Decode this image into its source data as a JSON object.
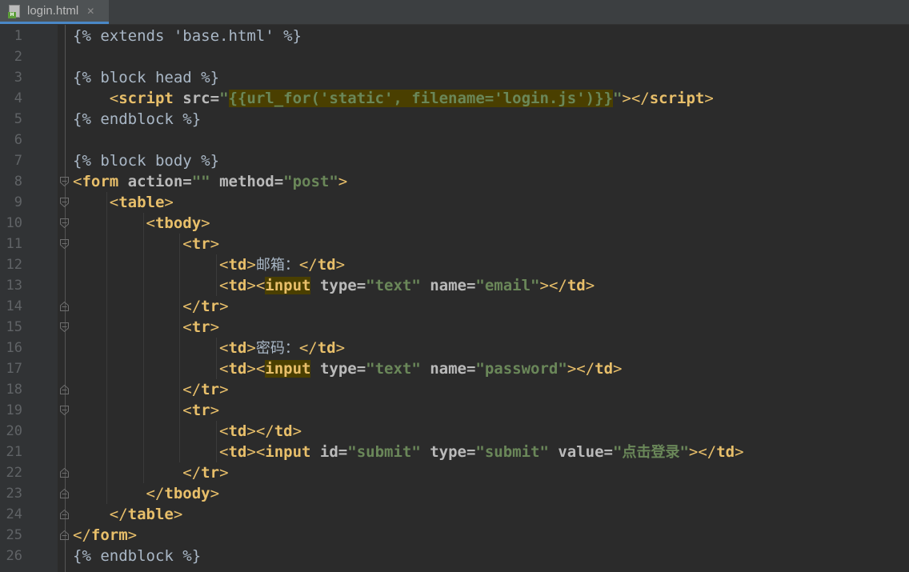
{
  "tab": {
    "file_name": "login.html",
    "icon_badge": "H",
    "close_glyph": "✕"
  },
  "colors": {
    "background": "#2b2b2b",
    "gutter": "#313335",
    "line_number": "#606366",
    "template_text": "#a9b7c6",
    "tag": "#e8bf6a",
    "attribute": "#bababa",
    "string": "#6a8759",
    "match_highlight": "#4a3f00",
    "active_tab_underline": "#4a88c7"
  },
  "lines": [
    {
      "n": "1",
      "indent": 0,
      "fold": "none",
      "tokens": [
        {
          "t": "{% extends 'base.html' %}",
          "c": "tp"
        }
      ]
    },
    {
      "n": "2",
      "indent": 0,
      "fold": "none",
      "tokens": []
    },
    {
      "n": "3",
      "indent": 0,
      "fold": "none",
      "tokens": [
        {
          "t": "{% block head %}",
          "c": "tp"
        }
      ]
    },
    {
      "n": "4",
      "indent": 4,
      "fold": "none",
      "tokens": [
        {
          "t": "<",
          "c": "pu"
        },
        {
          "t": "script ",
          "c": "tg"
        },
        {
          "t": "src=",
          "c": "at"
        },
        {
          "t": "\"",
          "c": "st"
        },
        {
          "t": "{{url_for('static', filename='login.js')}}",
          "c": "st hl"
        },
        {
          "t": "\"",
          "c": "st"
        },
        {
          "t": "></",
          "c": "pu"
        },
        {
          "t": "script",
          "c": "tg"
        },
        {
          "t": ">",
          "c": "pu"
        }
      ]
    },
    {
      "n": "5",
      "indent": 0,
      "fold": "none",
      "tokens": [
        {
          "t": "{% endblock %}",
          "c": "tp"
        }
      ]
    },
    {
      "n": "6",
      "indent": 0,
      "fold": "none",
      "tokens": []
    },
    {
      "n": "7",
      "indent": 0,
      "fold": "none",
      "tokens": [
        {
          "t": "{% block body %}",
          "c": "tp"
        }
      ]
    },
    {
      "n": "8",
      "indent": 0,
      "fold": "open",
      "tokens": [
        {
          "t": "<",
          "c": "pu"
        },
        {
          "t": "form ",
          "c": "tg"
        },
        {
          "t": "action=",
          "c": "at"
        },
        {
          "t": "\"\" ",
          "c": "st"
        },
        {
          "t": "method=",
          "c": "at"
        },
        {
          "t": "\"post\"",
          "c": "st"
        },
        {
          "t": ">",
          "c": "pu"
        }
      ]
    },
    {
      "n": "9",
      "indent": 4,
      "fold": "open",
      "tokens": [
        {
          "t": "<",
          "c": "pu"
        },
        {
          "t": "table",
          "c": "tg"
        },
        {
          "t": ">",
          "c": "pu"
        }
      ]
    },
    {
      "n": "10",
      "indent": 8,
      "fold": "open",
      "tokens": [
        {
          "t": "<",
          "c": "pu"
        },
        {
          "t": "tbody",
          "c": "tg"
        },
        {
          "t": ">",
          "c": "pu"
        }
      ]
    },
    {
      "n": "11",
      "indent": 12,
      "fold": "open",
      "tokens": [
        {
          "t": "<",
          "c": "pu"
        },
        {
          "t": "tr",
          "c": "tg"
        },
        {
          "t": ">",
          "c": "pu"
        }
      ]
    },
    {
      "n": "12",
      "indent": 16,
      "fold": "none",
      "tokens": [
        {
          "t": "<",
          "c": "pu"
        },
        {
          "t": "td",
          "c": "tg"
        },
        {
          "t": ">",
          "c": "pu"
        },
        {
          "t": "邮箱：",
          "c": "tp cn"
        },
        {
          "t": "</",
          "c": "pu"
        },
        {
          "t": "td",
          "c": "tg"
        },
        {
          "t": ">",
          "c": "pu"
        }
      ]
    },
    {
      "n": "13",
      "indent": 16,
      "fold": "none",
      "tokens": [
        {
          "t": "<",
          "c": "pu"
        },
        {
          "t": "td",
          "c": "tg"
        },
        {
          "t": ">",
          "c": "pu"
        },
        {
          "t": "<",
          "c": "pu"
        },
        {
          "t": "input",
          "c": "tg hl"
        },
        {
          "t": " ",
          "c": "tg"
        },
        {
          "t": "type=",
          "c": "at"
        },
        {
          "t": "\"text\" ",
          "c": "st"
        },
        {
          "t": "name=",
          "c": "at"
        },
        {
          "t": "\"email\"",
          "c": "st"
        },
        {
          "t": "></",
          "c": "pu"
        },
        {
          "t": "td",
          "c": "tg"
        },
        {
          "t": ">",
          "c": "pu"
        }
      ]
    },
    {
      "n": "14",
      "indent": 12,
      "fold": "close",
      "tokens": [
        {
          "t": "</",
          "c": "pu"
        },
        {
          "t": "tr",
          "c": "tg"
        },
        {
          "t": ">",
          "c": "pu"
        }
      ]
    },
    {
      "n": "15",
      "indent": 12,
      "fold": "open",
      "tokens": [
        {
          "t": "<",
          "c": "pu"
        },
        {
          "t": "tr",
          "c": "tg"
        },
        {
          "t": ">",
          "c": "pu"
        }
      ]
    },
    {
      "n": "16",
      "indent": 16,
      "fold": "none",
      "tokens": [
        {
          "t": "<",
          "c": "pu"
        },
        {
          "t": "td",
          "c": "tg"
        },
        {
          "t": ">",
          "c": "pu"
        },
        {
          "t": "密码：",
          "c": "tp cn"
        },
        {
          "t": "</",
          "c": "pu"
        },
        {
          "t": "td",
          "c": "tg"
        },
        {
          "t": ">",
          "c": "pu"
        }
      ]
    },
    {
      "n": "17",
      "indent": 16,
      "fold": "none",
      "tokens": [
        {
          "t": "<",
          "c": "pu"
        },
        {
          "t": "td",
          "c": "tg"
        },
        {
          "t": ">",
          "c": "pu"
        },
        {
          "t": "<",
          "c": "pu"
        },
        {
          "t": "input",
          "c": "tg hl"
        },
        {
          "t": " ",
          "c": "tg"
        },
        {
          "t": "type=",
          "c": "at"
        },
        {
          "t": "\"text\" ",
          "c": "st"
        },
        {
          "t": "name=",
          "c": "at"
        },
        {
          "t": "\"password\"",
          "c": "st"
        },
        {
          "t": "></",
          "c": "pu"
        },
        {
          "t": "td",
          "c": "tg"
        },
        {
          "t": ">",
          "c": "pu"
        }
      ]
    },
    {
      "n": "18",
      "indent": 12,
      "fold": "close",
      "tokens": [
        {
          "t": "</",
          "c": "pu"
        },
        {
          "t": "tr",
          "c": "tg"
        },
        {
          "t": ">",
          "c": "pu"
        }
      ]
    },
    {
      "n": "19",
      "indent": 12,
      "fold": "open",
      "tokens": [
        {
          "t": "<",
          "c": "pu"
        },
        {
          "t": "tr",
          "c": "tg"
        },
        {
          "t": ">",
          "c": "pu"
        }
      ]
    },
    {
      "n": "20",
      "indent": 16,
      "fold": "none",
      "tokens": [
        {
          "t": "<",
          "c": "pu"
        },
        {
          "t": "td",
          "c": "tg"
        },
        {
          "t": "></",
          "c": "pu"
        },
        {
          "t": "td",
          "c": "tg"
        },
        {
          "t": ">",
          "c": "pu"
        }
      ]
    },
    {
      "n": "21",
      "indent": 16,
      "fold": "none",
      "tokens": [
        {
          "t": "<",
          "c": "pu"
        },
        {
          "t": "td",
          "c": "tg"
        },
        {
          "t": ">",
          "c": "pu"
        },
        {
          "t": "<",
          "c": "pu"
        },
        {
          "t": "input ",
          "c": "tg"
        },
        {
          "t": "id=",
          "c": "at"
        },
        {
          "t": "\"submit\" ",
          "c": "st"
        },
        {
          "t": "type=",
          "c": "at"
        },
        {
          "t": "\"submit\" ",
          "c": "st"
        },
        {
          "t": "value=",
          "c": "at"
        },
        {
          "t": "\"",
          "c": "st"
        },
        {
          "t": "点击登录",
          "c": "st cn"
        },
        {
          "t": "\"",
          "c": "st"
        },
        {
          "t": "></",
          "c": "pu"
        },
        {
          "t": "td",
          "c": "tg"
        },
        {
          "t": ">",
          "c": "pu"
        }
      ]
    },
    {
      "n": "22",
      "indent": 12,
      "fold": "close",
      "tokens": [
        {
          "t": "</",
          "c": "pu"
        },
        {
          "t": "tr",
          "c": "tg"
        },
        {
          "t": ">",
          "c": "pu"
        }
      ]
    },
    {
      "n": "23",
      "indent": 8,
      "fold": "close",
      "tokens": [
        {
          "t": "</",
          "c": "pu"
        },
        {
          "t": "tbody",
          "c": "tg"
        },
        {
          "t": ">",
          "c": "pu"
        }
      ]
    },
    {
      "n": "24",
      "indent": 4,
      "fold": "close",
      "tokens": [
        {
          "t": "</",
          "c": "pu"
        },
        {
          "t": "table",
          "c": "tg"
        },
        {
          "t": ">",
          "c": "pu"
        }
      ]
    },
    {
      "n": "25",
      "indent": 0,
      "fold": "close",
      "tokens": [
        {
          "t": "</",
          "c": "pu"
        },
        {
          "t": "form",
          "c": "tg"
        },
        {
          "t": ">",
          "c": "pu"
        }
      ]
    },
    {
      "n": "26",
      "indent": 0,
      "fold": "none",
      "tokens": [
        {
          "t": "{% endblock %}",
          "c": "tp"
        }
      ]
    }
  ]
}
